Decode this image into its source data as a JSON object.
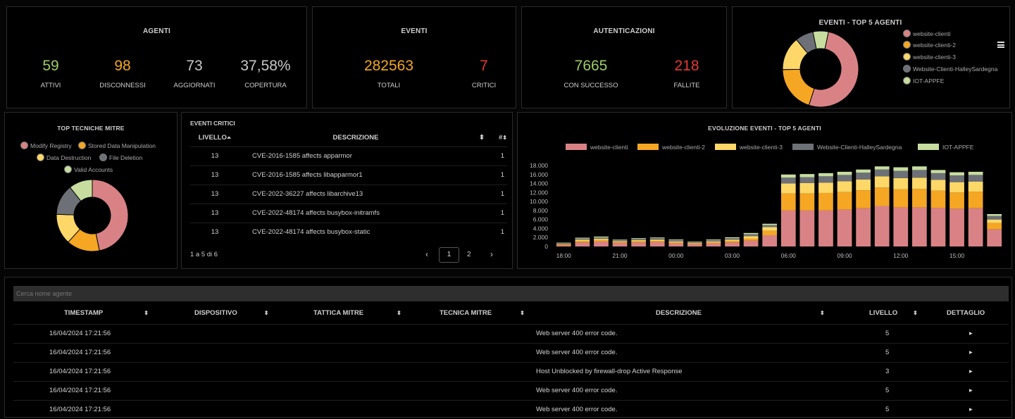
{
  "agenti": {
    "title": "AGENTI",
    "stats": [
      {
        "value": "59",
        "label": "ATTIVI",
        "color": "#9ccc65"
      },
      {
        "value": "98",
        "label": "DISCONNESSI",
        "color": "#f5a623"
      },
      {
        "value": "73",
        "label": "AGGIORNATI",
        "color": "#c8c8c8"
      },
      {
        "value": "37,58%",
        "label": "COPERTURA",
        "color": "#c8c8c8"
      }
    ]
  },
  "eventi": {
    "title": "EVENTI",
    "stats": [
      {
        "value": "282563",
        "label": "TOTALI",
        "color": "#f5a623"
      },
      {
        "value": "7",
        "label": "CRITICI",
        "color": "#e53935"
      }
    ]
  },
  "autenticazioni": {
    "title": "AUTENTICAZIONI",
    "stats": [
      {
        "value": "7665",
        "label": "CON SUCCESSO",
        "color": "#9ccc65"
      },
      {
        "value": "218",
        "label": "FALLITE",
        "color": "#e53935"
      }
    ]
  },
  "top5_agents": {
    "title": "EVENTI - TOP 5 AGENTI",
    "menu_icon": "hamburger-icon",
    "legend": [
      {
        "name": "website-clienti",
        "color": "#d98285"
      },
      {
        "name": "website-clienti-2",
        "color": "#f5a623"
      },
      {
        "name": "website-clienti-3",
        "color": "#fdd868"
      },
      {
        "name": "Website-Clienti-HalleySardegna",
        "color": "#6d7177"
      },
      {
        "name": "IOT-APPFE",
        "color": "#c7dd9f"
      }
    ],
    "values": [
      47,
      18,
      13,
      7,
      6
    ]
  },
  "mitre": {
    "title": "TOP TECNICHE MITRE",
    "legend": [
      {
        "name": "Modify Registry",
        "color": "#d98285"
      },
      {
        "name": "Stored Data Manipulation",
        "color": "#f5a623"
      },
      {
        "name": "Data Destruction",
        "color": "#fdd868"
      },
      {
        "name": "File Deletion",
        "color": "#6d7177"
      },
      {
        "name": "Valid Accounts",
        "color": "#c7dd9f"
      }
    ],
    "values": [
      44,
      14,
      13,
      13,
      10
    ]
  },
  "critici": {
    "title": "EVENTI CRITICI",
    "headers": {
      "livello": "LIVELLO",
      "descrizione": "DESCRIZIONE",
      "count": "#"
    },
    "rows": [
      {
        "livello": "13",
        "descrizione": "CVE-2016-1585 affects apparmor",
        "count": "1"
      },
      {
        "livello": "13",
        "descrizione": "CVE-2016-1585 affects libapparmor1",
        "count": "1"
      },
      {
        "livello": "13",
        "descrizione": "CVE-2022-36227 affects libarchive13",
        "count": "1"
      },
      {
        "livello": "13",
        "descrizione": "CVE-2022-48174 affects busybox-initramfs",
        "count": "1"
      },
      {
        "livello": "13",
        "descrizione": "CVE-2022-48174 affects busybox-static",
        "count": "1"
      }
    ],
    "pagination": {
      "info": "1 a 5 di 6",
      "prev": "‹",
      "pages": [
        "1",
        "2"
      ],
      "next": "›"
    }
  },
  "evoluzione": {
    "title": "EVOLUZIONE EVENTI - TOP 5 AGENTI"
  },
  "chart_data": {
    "type": "bar",
    "stacked": true,
    "title": "EVOLUZIONE EVENTI - TOP 5 AGENTI",
    "xticks": [
      "18:00",
      "21:00",
      "00:00",
      "03:00",
      "06:00",
      "09:00",
      "12:00",
      "15:00"
    ],
    "yticks": [
      "0",
      "2.000",
      "4.000",
      "6.000",
      "8.000",
      "10.000",
      "12.000",
      "14.000",
      "16.000",
      "18.000"
    ],
    "ylim": [
      0,
      18000
    ],
    "legend_position": "top",
    "series": [
      {
        "name": "website-clienti",
        "color": "#d98285",
        "values": [
          350,
          900,
          1100,
          800,
          900,
          1000,
          700,
          500,
          700,
          900,
          1300,
          2500,
          8000,
          8000,
          8000,
          8200,
          8500,
          9000,
          8700,
          8700,
          8600,
          8400,
          8500,
          3800
        ]
      },
      {
        "name": "website-clienti-2",
        "color": "#f5a623",
        "values": [
          150,
          300,
          300,
          200,
          250,
          250,
          200,
          150,
          200,
          300,
          500,
          1000,
          3800,
          3800,
          3900,
          3900,
          4000,
          4100,
          4000,
          4100,
          3800,
          3600,
          3700,
          1400
        ]
      },
      {
        "name": "website-clienti-3",
        "color": "#fdd868",
        "values": [
          100,
          300,
          300,
          200,
          250,
          250,
          200,
          150,
          200,
          300,
          500,
          800,
          2200,
          2300,
          2300,
          2400,
          2400,
          2500,
          2500,
          2500,
          2400,
          2300,
          2200,
          800
        ]
      },
      {
        "name": "Website-Clienti-HalleySardegna",
        "color": "#6d7177",
        "values": [
          150,
          300,
          300,
          250,
          300,
          350,
          300,
          200,
          300,
          350,
          450,
          450,
          1300,
          1300,
          1400,
          1400,
          1500,
          1500,
          1600,
          1700,
          1500,
          1500,
          1500,
          800
        ]
      },
      {
        "name": "IOT-APPFE",
        "color": "#c7dd9f",
        "values": [
          100,
          150,
          200,
          100,
          150,
          150,
          150,
          100,
          150,
          200,
          250,
          300,
          700,
          700,
          700,
          700,
          700,
          700,
          800,
          800,
          700,
          700,
          700,
          400
        ]
      }
    ]
  },
  "bottom": {
    "search_placeholder": "Cerca nome agente",
    "headers": {
      "timestamp": "TIMESTAMP",
      "dispositivo": "DISPOSITIVO",
      "tattica": "TATTICA MITRE",
      "tecnica": "TECNICA MITRE",
      "descrizione": "DESCRIZIONE",
      "livello": "LIVELLO",
      "dettaglio": "DETTAGLIO"
    },
    "rows": [
      {
        "timestamp": "16/04/2024 17:21:56",
        "descrizione": "Web server 400 error code.",
        "livello": "5"
      },
      {
        "timestamp": "16/04/2024 17:21:56",
        "descrizione": "Web server 400 error code.",
        "livello": "5"
      },
      {
        "timestamp": "16/04/2024 17:21:56",
        "descrizione": "Host Unblocked by firewall-drop Active Response",
        "livello": "3"
      },
      {
        "timestamp": "16/04/2024 17:21:56",
        "descrizione": "Web server 400 error code.",
        "livello": "5"
      },
      {
        "timestamp": "16/04/2024 17:21:56",
        "descrizione": "Web server 400 error code.",
        "livello": "5"
      }
    ]
  }
}
